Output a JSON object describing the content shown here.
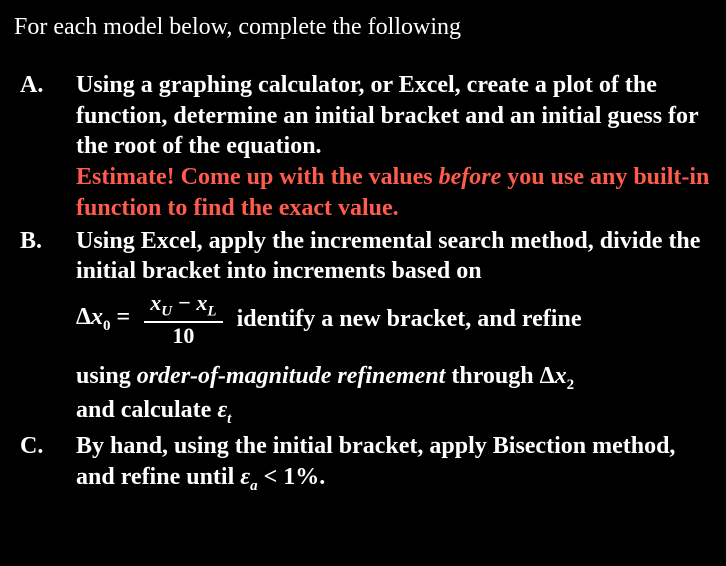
{
  "intro": "For each model below, complete the following",
  "items": {
    "a": {
      "marker": "A.",
      "line1": "Using a graphing calculator, or Excel, create a plot of the function, determine an initial bracket and an initial guess for the root of the equation.",
      "warn_prefix": "Estimate! Come up with the values ",
      "warn_emph": "before",
      "warn_suffix": " you use any built-in function to find the exact value."
    },
    "b": {
      "marker": "B.",
      "line1": "Using Excel, apply the incremental search method, divide the initial bracket into increments based on",
      "formula": {
        "lhs_delta": "Δ",
        "lhs_x": "x",
        "lhs_sub": "0",
        "eq": " = ",
        "num_x1": "x",
        "num_sub1": "U",
        "num_minus": " − ",
        "num_x2": "x",
        "num_sub2": "L",
        "den": "10"
      },
      "after_formula": "identify a new bracket, and refine",
      "line2_pre": "using ",
      "line2_emph": "order-of-magnitude refinement",
      "line2_mid": " through ",
      "dx2_delta": "Δ",
      "dx2_x": "x",
      "dx2_sub": "2",
      "line3_pre": " and calculate ",
      "eps": "ε",
      "eps_sub": "t"
    },
    "c": {
      "marker": "C.",
      "line1_pre": "By hand, using the initial bracket, apply Bisection method, and refine until ",
      "eps": "ε",
      "eps_sub": "a",
      "line1_post": " < 1%."
    }
  }
}
